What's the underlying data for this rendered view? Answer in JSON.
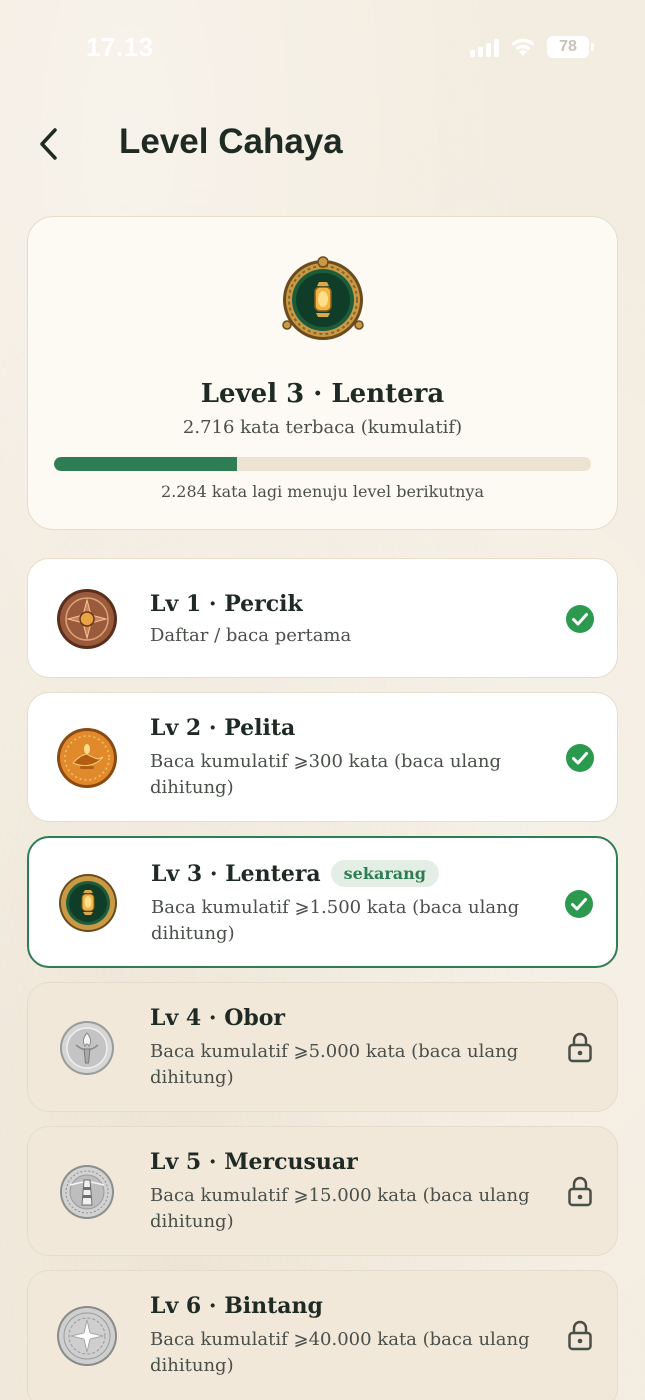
{
  "status_bar": {
    "time": "17.13",
    "battery": "78"
  },
  "header": {
    "title": "Level Cahaya"
  },
  "summary": {
    "level_label": "Level 3 · Lentera",
    "words_read": "2.716 kata terbaca (kumulatif)",
    "progress_fraction": 0.34,
    "remaining": "2.284 kata lagi menuju level berikutnya"
  },
  "colors": {
    "accent_green": "#2f7d55",
    "check_green": "#2c9a4e",
    "locked_bg": "#f1e8da",
    "page_bg": "#f3ece0"
  },
  "levels": [
    {
      "title": "Lv 1 · Percik",
      "desc": "Daftar / baca pertama",
      "status": "done",
      "medal": "bronze-medal-icon"
    },
    {
      "title": "Lv 2 · Pelita",
      "desc": "Baca kumulatif ⩾300 kata (baca ulang dihitung)",
      "status": "done",
      "medal": "oil-lamp-medal-icon"
    },
    {
      "title": "Lv 3 · Lentera",
      "desc": "Baca kumulatif ⩾1.500 kata (baca ulang dihitung)",
      "status": "current",
      "badge": "sekarang",
      "medal": "lantern-medal-icon"
    },
    {
      "title": "Lv 4 · Obor",
      "desc": "Baca kumulatif ⩾5.000 kata (baca ulang dihitung)",
      "status": "locked",
      "medal": "torch-medal-icon"
    },
    {
      "title": "Lv 5 · Mercusuar",
      "desc": "Baca kumulatif ⩾15.000 kata (baca ulang dihitung)",
      "status": "locked",
      "medal": "lighthouse-medal-icon"
    },
    {
      "title": "Lv 6 · Bintang",
      "desc": "Baca kumulatif ⩾40.000 kata (baca ulang dihitung)",
      "status": "locked",
      "medal": "star-medal-icon"
    }
  ]
}
